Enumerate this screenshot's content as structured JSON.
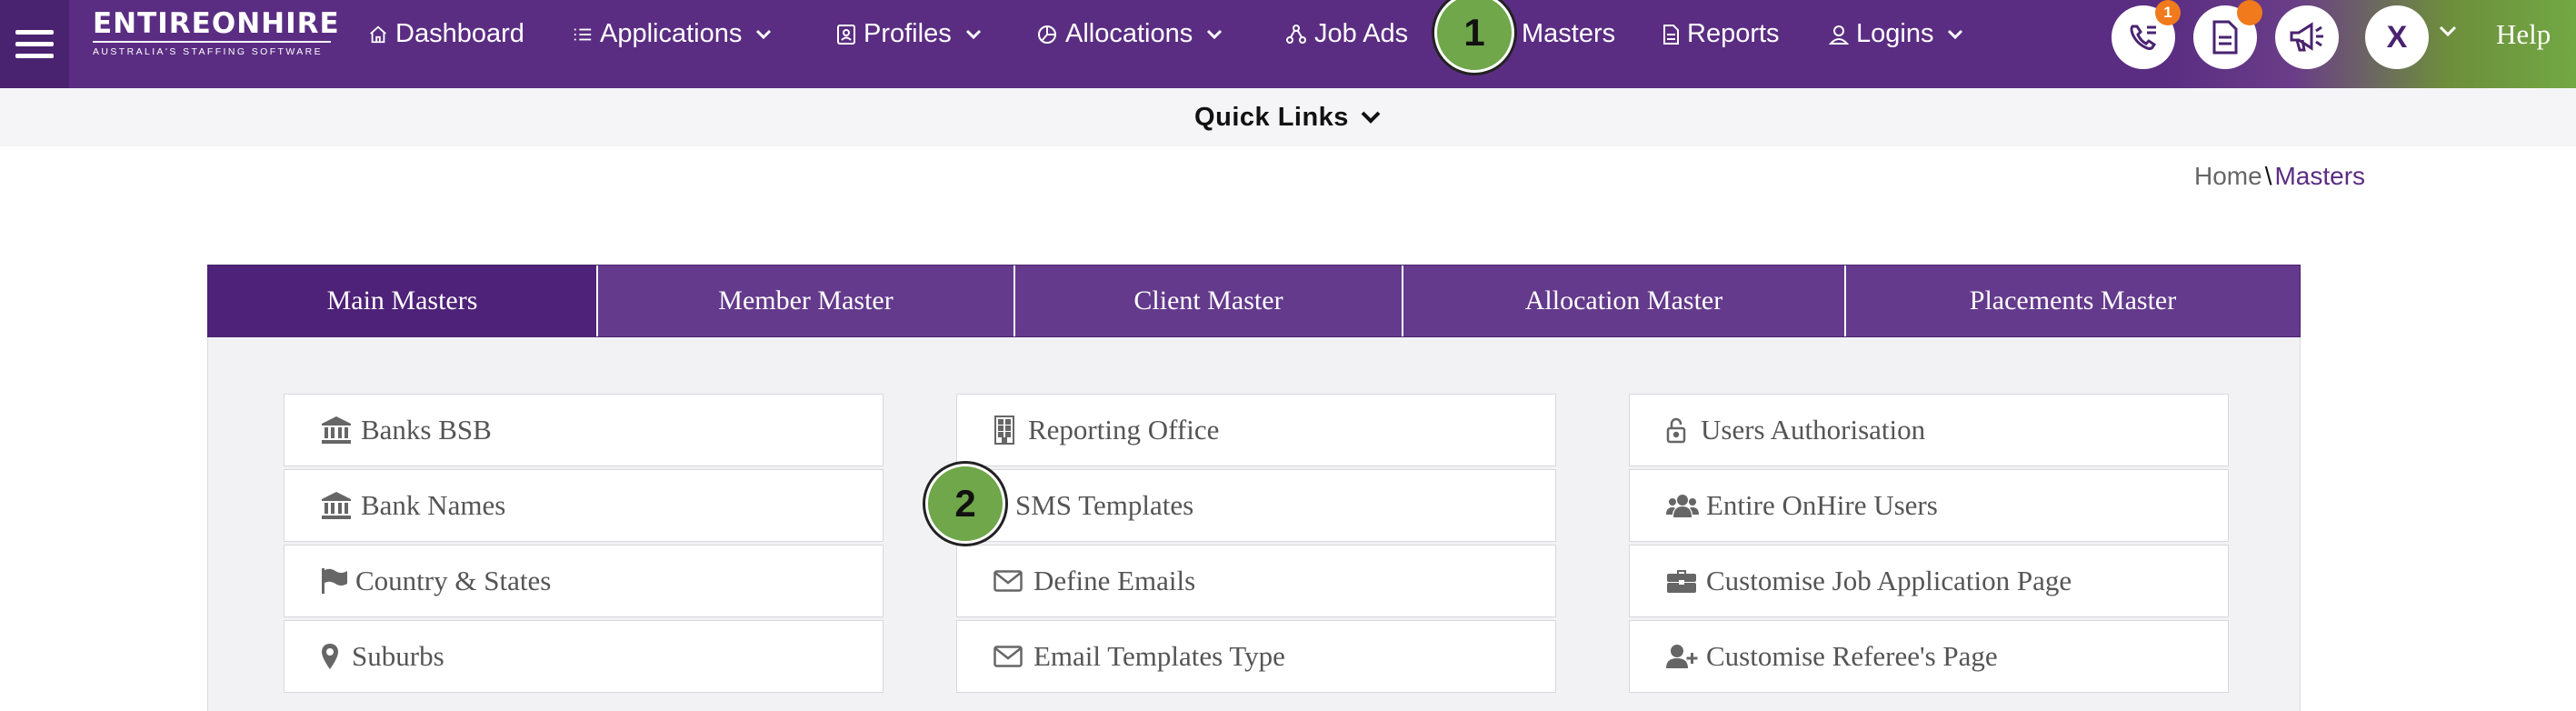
{
  "logo": {
    "main": "ENTIREONHIRE",
    "sub": "AUSTRALIA'S STAFFING SOFTWARE"
  },
  "nav": [
    {
      "label": "Dashboard",
      "icon": "home-icon",
      "has_dropdown": false
    },
    {
      "label": "Applications",
      "icon": "list-icon",
      "has_dropdown": true
    },
    {
      "label": "Profiles",
      "icon": "id-card-icon",
      "has_dropdown": true
    },
    {
      "label": "Allocations",
      "icon": "pie-chart-icon",
      "has_dropdown": true
    },
    {
      "label": "Job Ads",
      "icon": "network-icon",
      "has_dropdown": false
    },
    {
      "label": "Masters",
      "icon": "grid-icon",
      "has_dropdown": false
    },
    {
      "label": "Reports",
      "icon": "document-icon",
      "has_dropdown": false
    },
    {
      "label": "Logins",
      "icon": "user-icon",
      "has_dropdown": true
    }
  ],
  "header_actions": {
    "calls_badge": "1",
    "avatar_initial": "X",
    "help": "Help"
  },
  "quick_links": "Quick Links",
  "breadcrumb": {
    "home": "Home",
    "separator": "\\",
    "current": "Masters"
  },
  "tabs": [
    {
      "label": "Main Masters",
      "active": true
    },
    {
      "label": "Member Master",
      "active": false
    },
    {
      "label": "Client Master",
      "active": false
    },
    {
      "label": "Allocation Master",
      "active": false
    },
    {
      "label": "Placements Master",
      "active": false
    }
  ],
  "columns": [
    [
      {
        "label": "Banks BSB",
        "icon": "bank-icon"
      },
      {
        "label": "Bank Names",
        "icon": "bank-icon"
      },
      {
        "label": "Country & States",
        "icon": "flag-icon"
      },
      {
        "label": "Suburbs",
        "icon": "map-pin-icon"
      }
    ],
    [
      {
        "label": "Reporting Office",
        "icon": "building-icon"
      },
      {
        "label": "SMS Templates",
        "icon": ""
      },
      {
        "label": "Define Emails",
        "icon": "envelope-icon"
      },
      {
        "label": "Email Templates Type",
        "icon": "envelope-icon"
      }
    ],
    [
      {
        "label": "Users Authorisation",
        "icon": "unlock-icon"
      },
      {
        "label": "Entire OnHire Users",
        "icon": "users-icon"
      },
      {
        "label": "Customise Job Application Page",
        "icon": "briefcase-icon"
      },
      {
        "label": "Customise Referee's Page",
        "icon": "user-plus-icon"
      }
    ]
  ],
  "markers": [
    "1",
    "2"
  ],
  "colors": {
    "brand_purple": "#5a2d82",
    "brand_purple_dark": "#4a2370",
    "accent_green": "#72a843",
    "badge_orange": "#f07a1c",
    "marker_green": "#6fa74a"
  }
}
